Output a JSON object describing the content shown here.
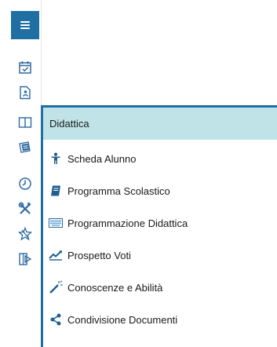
{
  "rail": {
    "icons": [
      "menu-icon",
      "calendar-check-icon",
      "document-person-icon",
      "book-icon",
      "bulletin-board-icon",
      "clock-icon",
      "tools-icon",
      "star-badge-icon",
      "logout-icon"
    ]
  },
  "menu": {
    "header": "Didattica",
    "items": [
      {
        "label": "Scheda Alunno",
        "icon": "person-icon"
      },
      {
        "label": "Programma Scolastico",
        "icon": "notebook-icon"
      },
      {
        "label": "Programmazione Didattica",
        "icon": "keyboard-icon"
      },
      {
        "label": "Prospetto Voti",
        "icon": "trend-chart-icon"
      },
      {
        "label": "Conoscenze e Abilità",
        "icon": "magic-wand-icon"
      },
      {
        "label": "Condivisione Documenti",
        "icon": "share-icon"
      }
    ]
  },
  "colors": {
    "accent": "#1f6fa3",
    "header_bg": "#bfe3e6",
    "menu_icon": "#1f5f8f"
  }
}
